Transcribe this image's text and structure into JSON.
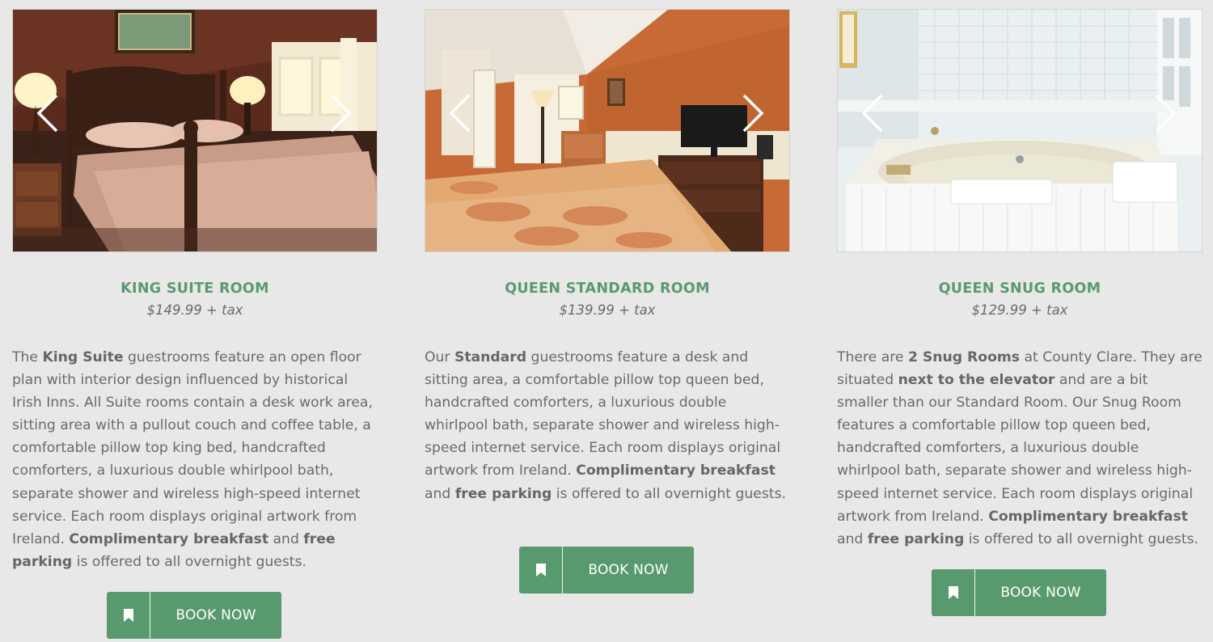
{
  "colors": {
    "accent": "#589a6d",
    "title": "#5a9a70",
    "background": "#e8e8e8",
    "text": "#6a6a6a"
  },
  "icons": {
    "prev": "chevron-left-icon",
    "next": "chevron-right-icon",
    "book": "bookmark-icon"
  },
  "rooms": [
    {
      "title": "KING SUITE ROOM",
      "price": "$149.99 + tax",
      "description": [
        {
          "t": "The ",
          "b": false
        },
        {
          "t": "King Suite",
          "b": true
        },
        {
          "t": " guestrooms feature an open floor plan with interior design influenced by historical Irish Inns. All Suite rooms contain a desk work area, sitting area with a pullout couch and coffee table, a comfortable pillow top king bed, handcrafted comforters, a luxurious double whirlpool bath, separate shower and wireless high-speed internet service. Each room displays original artwork from Ireland. ",
          "b": false
        },
        {
          "t": "Complimentary breakfast",
          "b": true
        },
        {
          "t": " and ",
          "b": false
        },
        {
          "t": "free parking",
          "b": true
        },
        {
          "t": " is offered to all overnight guests.",
          "b": false
        }
      ],
      "button_label": "BOOK NOW"
    },
    {
      "title": "QUEEN STANDARD ROOM",
      "price": "$139.99 + tax",
      "description": [
        {
          "t": "Our ",
          "b": false
        },
        {
          "t": "Standard",
          "b": true
        },
        {
          "t": " guestrooms feature a desk and sitting area, a comfortable pillow top queen bed, handcrafted comforters, a luxurious double whirlpool bath, separate shower and wireless high-speed internet service. Each room displays original artwork from Ireland. ",
          "b": false
        },
        {
          "t": "Complimentary breakfast",
          "b": true
        },
        {
          "t": " and ",
          "b": false
        },
        {
          "t": "free parking",
          "b": true
        },
        {
          "t": " is offered to all overnight guests.",
          "b": false
        }
      ],
      "button_label": "BOOK NOW"
    },
    {
      "title": "QUEEN SNUG ROOM",
      "price": "$129.99 + tax",
      "description": [
        {
          "t": "There are ",
          "b": false
        },
        {
          "t": "2 Snug Rooms",
          "b": true
        },
        {
          "t": " at County Clare. They are situated ",
          "b": false
        },
        {
          "t": "next to the elevator",
          "b": true
        },
        {
          "t": " and are a bit smaller than our Standard Room. Our Snug Room features a comfortable pillow top queen bed, handcrafted comforters, a luxurious double whirlpool bath, separate shower and wireless high-speed internet service. Each room displays original artwork from Ireland. ",
          "b": false
        },
        {
          "t": "Complimentary breakfast",
          "b": true
        },
        {
          "t": " and ",
          "b": false
        },
        {
          "t": "free parking",
          "b": true
        },
        {
          "t": " is offered to all overnight guests.",
          "b": false
        }
      ],
      "button_label": "BOOK NOW"
    }
  ]
}
